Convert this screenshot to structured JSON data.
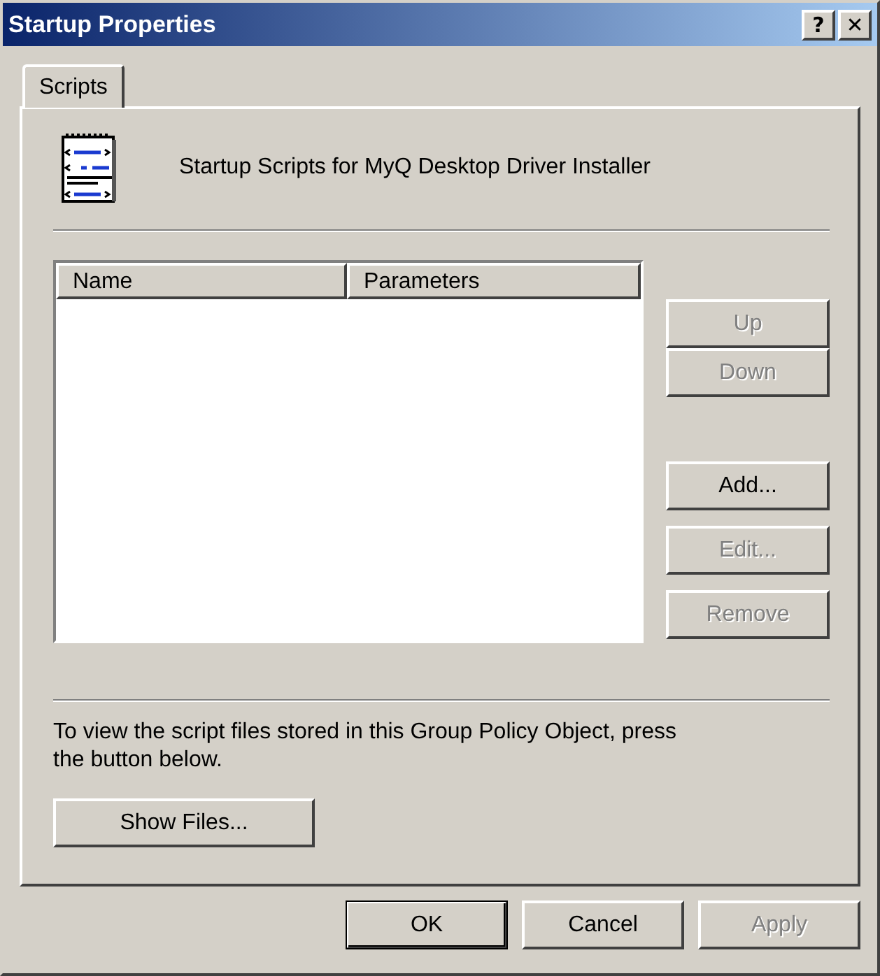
{
  "window": {
    "title": "Startup Properties",
    "controls": [
      "?",
      "✕"
    ]
  },
  "tabs": [
    {
      "label": "Scripts",
      "selected": true
    }
  ],
  "header": {
    "text": "Startup Scripts for MyQ Desktop Driver Installer"
  },
  "table": {
    "columns": [
      "Name",
      "Parameters"
    ]
  },
  "side_buttons": [
    {
      "label": "Up",
      "disabled": true
    },
    {
      "label": "Down",
      "disabled": true
    },
    {
      "label": "Add...",
      "disabled": false
    },
    {
      "label": "Edit...",
      "disabled": true
    },
    {
      "label": "Remove",
      "disabled": true
    }
  ],
  "note": "To view the script files stored in this Group Policy Object, press the button below.",
  "show_files_button": {
    "label": "Show Files...",
    "disabled": false
  },
  "buttons": [
    {
      "label": "OK",
      "disabled": false,
      "default": true
    },
    {
      "label": "Cancel",
      "disabled": false,
      "default": false
    },
    {
      "label": "Apply",
      "disabled": true,
      "default": false
    }
  ]
}
